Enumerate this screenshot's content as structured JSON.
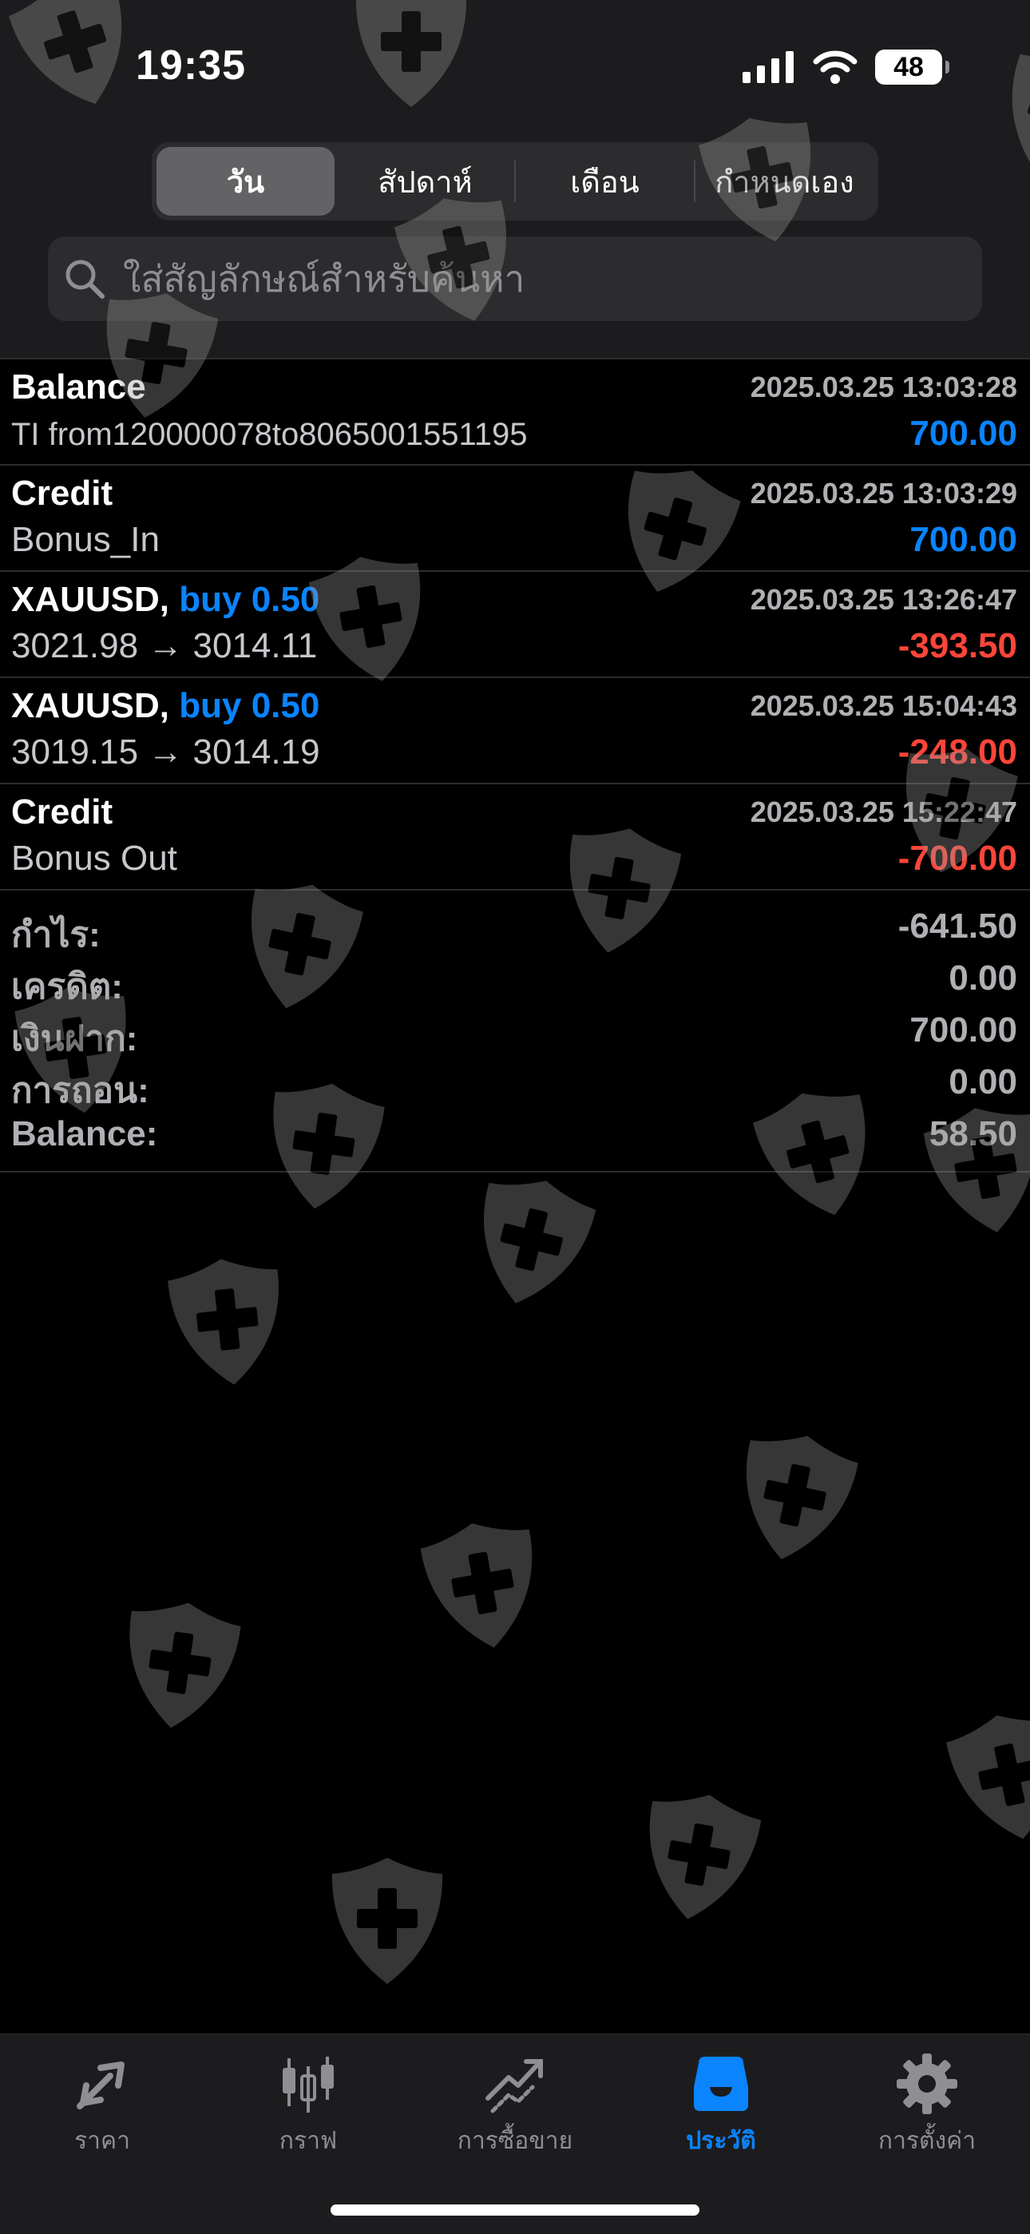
{
  "status_bar": {
    "time": "19:35",
    "battery": "48",
    "icons": [
      "signal-icon",
      "wifi-icon",
      "battery-icon"
    ]
  },
  "period_tabs": [
    {
      "label": "วัน",
      "active": true
    },
    {
      "label": "สัปดาห์",
      "active": false
    },
    {
      "label": "เดือน",
      "active": false
    },
    {
      "label": "กำหนดเอง",
      "active": false
    }
  ],
  "search": {
    "placeholder": "ใส่สัญลักษณ์สำหรับค้นหา"
  },
  "history": [
    {
      "title": "Balance",
      "side": "",
      "date": "2025.03.25 13:03:28",
      "sub": "TI from120000078to8065001551195",
      "amount": "700.00",
      "amount_sign": "positive"
    },
    {
      "title": "Credit",
      "side": "",
      "date": "2025.03.25 13:03:29",
      "sub": "Bonus_In",
      "amount": "700.00",
      "amount_sign": "positive"
    },
    {
      "title": "XAUUSD,",
      "side": "buy 0.50",
      "date": "2025.03.25 13:26:47",
      "sub": "3021.98 → 3014.11",
      "amount": "-393.50",
      "amount_sign": "negative"
    },
    {
      "title": "XAUUSD,",
      "side": "buy 0.50",
      "date": "2025.03.25 15:04:43",
      "sub": "3019.15 → 3014.19",
      "amount": "-248.00",
      "amount_sign": "negative"
    },
    {
      "title": "Credit",
      "side": "",
      "date": "2025.03.25 15:22:47",
      "sub": "Bonus Out",
      "amount": "-700.00",
      "amount_sign": "negative"
    }
  ],
  "summary": {
    "profit_label": "กำไร:",
    "profit_value": "-641.50",
    "credit_label": "เครดิต:",
    "credit_value": "0.00",
    "deposit_label": "เงินฝาก:",
    "deposit_value": "700.00",
    "withdrawal_label": "การถอน:",
    "withdrawal_value": "0.00",
    "balance_label": "Balance:",
    "balance_value": "58.50"
  },
  "tabbar": [
    {
      "label": "ราคา",
      "icon": "quotes-arrows-icon",
      "active": false
    },
    {
      "label": "กราฟ",
      "icon": "candlestick-chart-icon",
      "active": false
    },
    {
      "label": "การซื้อขาย",
      "icon": "trade-chart-icon",
      "active": false
    },
    {
      "label": "ประวัติ",
      "icon": "history-inbox-icon",
      "active": true
    },
    {
      "label": "การตั้งค่า",
      "icon": "gear-icon",
      "active": false
    }
  ],
  "colors": {
    "background": "#000000",
    "panel": "#1c1c1e",
    "accent_blue": "#0a84ff",
    "loss_red": "#ff453a",
    "muted": "#8e8e93"
  },
  "watermark_icon": "shield-cross-icon"
}
